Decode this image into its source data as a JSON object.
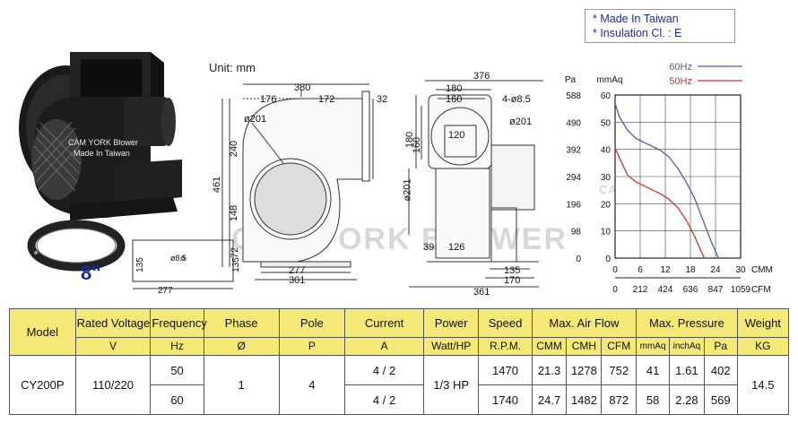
{
  "notes": [
    "* Made In Taiwan",
    "* Insulation Cl. : E"
  ],
  "photo": {
    "logo_caption": "CAM YORK Blower",
    "made_caption": "Made In Taiwan",
    "size_label": "8\""
  },
  "drawing": {
    "unit_label": "Unit: mm",
    "watermark": "CAM YORK BLOWER",
    "front_dims": {
      "overall_width": "380",
      "left_part": "176",
      "right_part": "172",
      "flange": "32",
      "inlet": "ø201",
      "height_total": "461",
      "upper": "240",
      "middle": "148",
      "lower": "72",
      "base_inner": "277",
      "base_outer": "301"
    },
    "side_dims": {
      "overall": "376",
      "flange_outer": "180",
      "flange_inner": "160",
      "holes": "4-ø8.5",
      "outlet": "ø201",
      "outlet_inner": "120",
      "height_outlet": "ø201",
      "h180": "180",
      "h160": "160",
      "leg_left": "39",
      "leg_width": "126",
      "base_inner": "135",
      "base_outer": "170",
      "total_length": "361"
    },
    "base_dims": {
      "hole": "ø8.5",
      "height_left": "135",
      "height_right": "135",
      "width": "277"
    }
  },
  "chart_data": {
    "type": "line",
    "title": "",
    "legend": [
      "60Hz",
      "50Hz"
    ],
    "legend_placement": "top-right",
    "grid": true,
    "xlabel_top": "CMM",
    "xlabel_bottom": "CFM",
    "ylabel_left": "Pa",
    "ylabel_right": "mmAq",
    "x_cmm_ticks": [
      "0",
      "6",
      "12",
      "18",
      "24",
      "30"
    ],
    "x_cfm_ticks": [
      "0",
      "212",
      "424",
      "636",
      "847",
      "1059"
    ],
    "y_pa_ticks": [
      "0",
      "98",
      "196",
      "294",
      "392",
      "490",
      "588"
    ],
    "y_mmaq_ticks": [
      "0",
      "10",
      "20",
      "30",
      "40",
      "50",
      "60"
    ],
    "xlim": [
      0,
      30
    ],
    "ylim": [
      0,
      60
    ],
    "series": [
      {
        "name": "60Hz",
        "color": "#4a5ea8",
        "x": [
          0,
          1,
          3,
          5,
          7,
          9,
          11,
          13,
          15,
          17,
          19,
          21,
          23,
          24.7
        ],
        "y": [
          57,
          52,
          47,
          44,
          42.5,
          41,
          39.5,
          37,
          33,
          28,
          22,
          14,
          6,
          0
        ]
      },
      {
        "name": "50Hz",
        "color": "#cc3333",
        "x": [
          0,
          1,
          3,
          5,
          7,
          9,
          11,
          13,
          15,
          17,
          19,
          20,
          21.3
        ],
        "y": [
          40.5,
          37,
          30.5,
          28,
          26.5,
          25,
          23.5,
          21.5,
          18.5,
          14,
          8,
          4.5,
          0
        ]
      }
    ]
  },
  "table": {
    "header1": [
      "Model",
      "Rated Voltage",
      "Frequency",
      "Phase",
      "Pole",
      "Current",
      "Power",
      "Speed",
      "Max. Air Flow",
      "Max. Pressure",
      "Weight"
    ],
    "header2": [
      "V",
      "Hz",
      "Ø",
      "P",
      "A",
      "Watt/HP",
      "R.P.M.",
      "CMM",
      "CMH",
      "CFM",
      "mmAq",
      "inchAq",
      "Pa",
      "KG"
    ],
    "model": "CY200P",
    "voltage": "110/220",
    "phase": "1",
    "pole": "4",
    "power": "1/3 HP",
    "weight": "14.5",
    "rows": [
      {
        "freq": "50",
        "current": "4 / 2",
        "rpm": "1470",
        "cmm": "21.3",
        "cmh": "1278",
        "cfm": "752",
        "mmaq": "41",
        "inchaq": "1.61",
        "pa": "402"
      },
      {
        "freq": "60",
        "current": "4 / 2",
        "rpm": "1740",
        "cmm": "24.7",
        "cmh": "1482",
        "cfm": "872",
        "mmaq": "58",
        "inchaq": "2.28",
        "pa": "569"
      }
    ]
  }
}
